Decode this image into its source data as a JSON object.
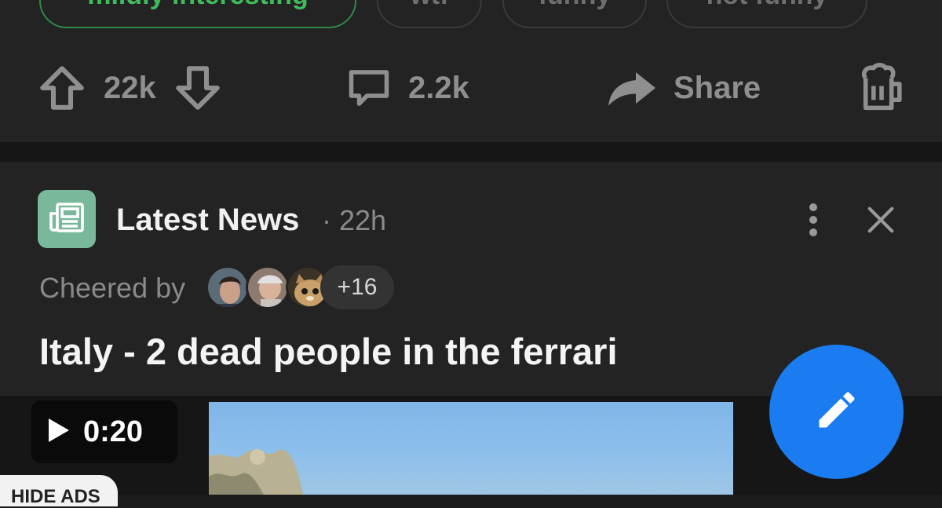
{
  "tags": [
    {
      "label": "mildly interesting",
      "active": true
    },
    {
      "label": "wtf",
      "active": false
    },
    {
      "label": "funny",
      "active": false
    },
    {
      "label": "not funny",
      "active": false
    }
  ],
  "actions": {
    "upvotes": "22k",
    "comments": "2.2k",
    "share_label": "Share"
  },
  "post": {
    "section": "Latest News",
    "time": "· 22h",
    "cheered_by_label": "Cheered by",
    "cheer_extra": "+16",
    "title": "Italy - 2 dead people in the ferrari",
    "video_duration": "0:20"
  },
  "ads": {
    "hide_label": "HIDE ADS"
  },
  "colors": {
    "accent_green": "#3fbb5c",
    "fab_blue": "#1a7cf0",
    "section_avatar": "#7ab89c"
  },
  "icons": [
    "upvote-arrow-icon",
    "downvote-arrow-icon",
    "comment-bubble-icon",
    "share-arrow-icon",
    "beer-mug-icon",
    "newspaper-icon",
    "more-vertical-icon",
    "close-icon",
    "play-icon",
    "pencil-icon"
  ]
}
